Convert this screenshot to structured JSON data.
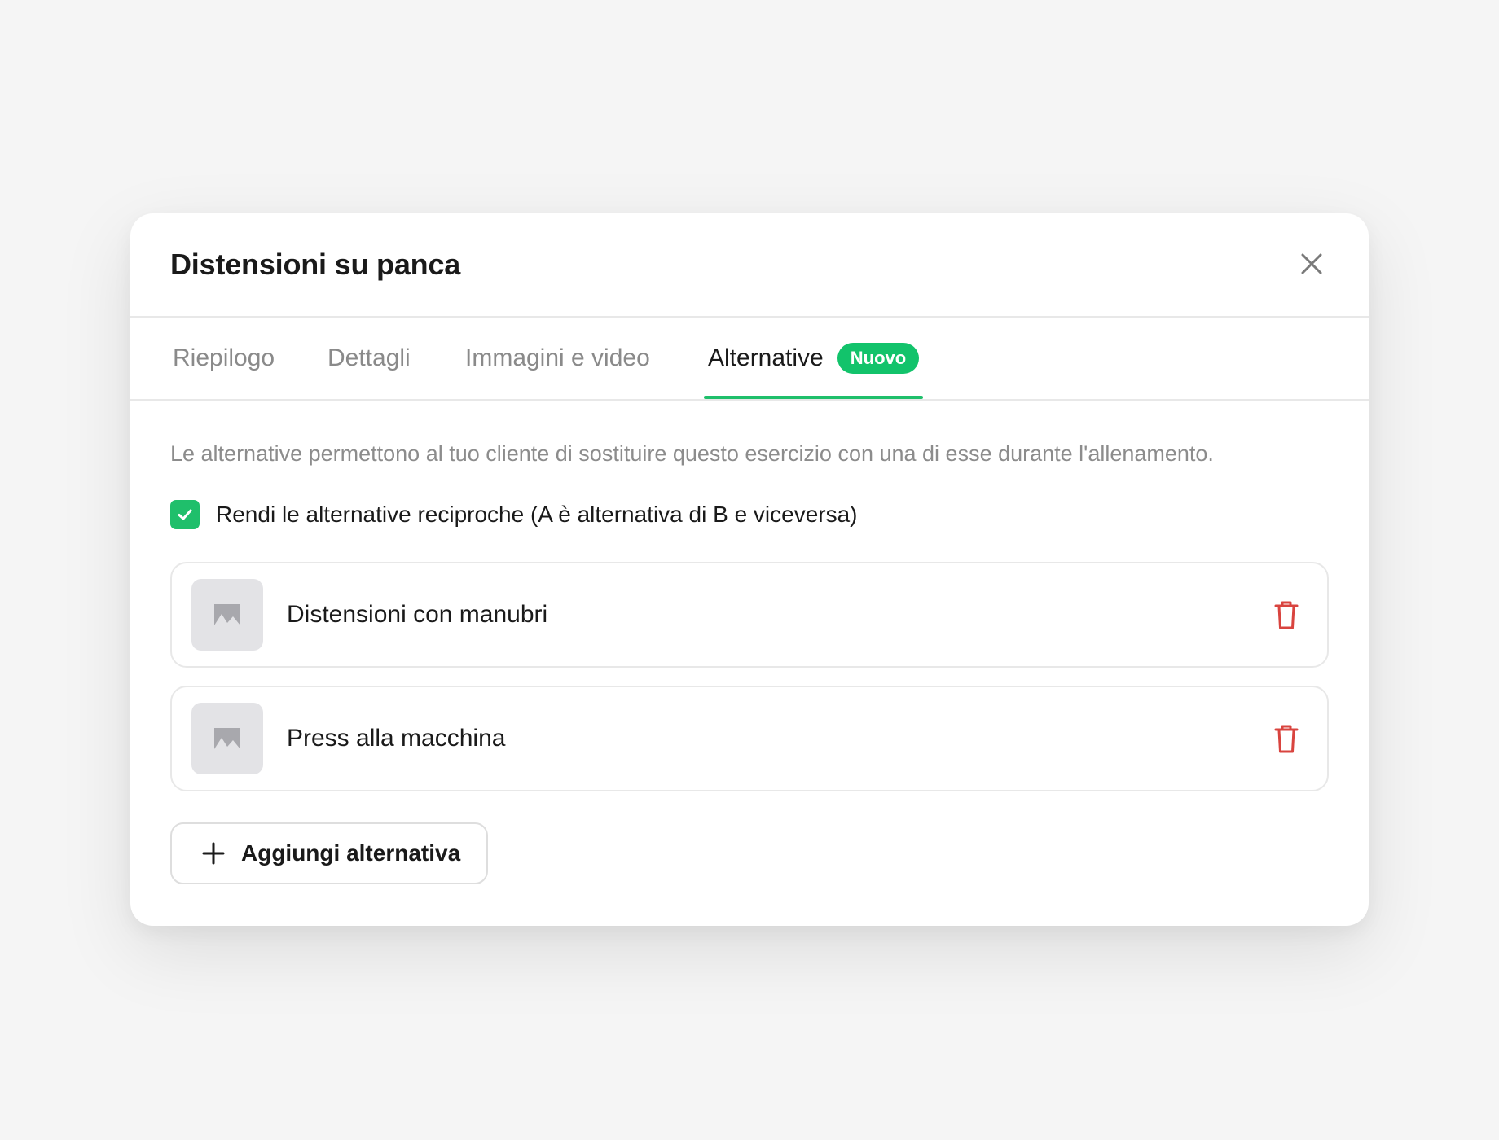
{
  "modal": {
    "title": "Distensioni su panca"
  },
  "tabs": [
    {
      "label": "Riepilogo",
      "active": false
    },
    {
      "label": "Dettagli",
      "active": false
    },
    {
      "label": "Immagini e video",
      "active": false
    },
    {
      "label": "Alternative",
      "active": true,
      "badge": "Nuovo"
    }
  ],
  "alternatives_panel": {
    "description": "Le alternative permettono al tuo cliente di sostituire questo esercizio con una di esse durante l'allenamento.",
    "reciprocal_checkbox": {
      "label": "Rendi le alternative reciproche (A è alternativa di B e viceversa)",
      "checked": true
    },
    "items": [
      {
        "name": "Distensioni con manubri",
        "thumbnail_icon": "image-placeholder-icon"
      },
      {
        "name": "Press alla macchina",
        "thumbnail_icon": "image-placeholder-icon"
      }
    ],
    "add_button_label": "Aggiungi alternativa"
  },
  "colors": {
    "accent": "#1fbf6b",
    "badge": "#12c36b",
    "delete": "#d9443f",
    "muted_text": "#8c8c8c",
    "text": "#1a1a1a"
  }
}
